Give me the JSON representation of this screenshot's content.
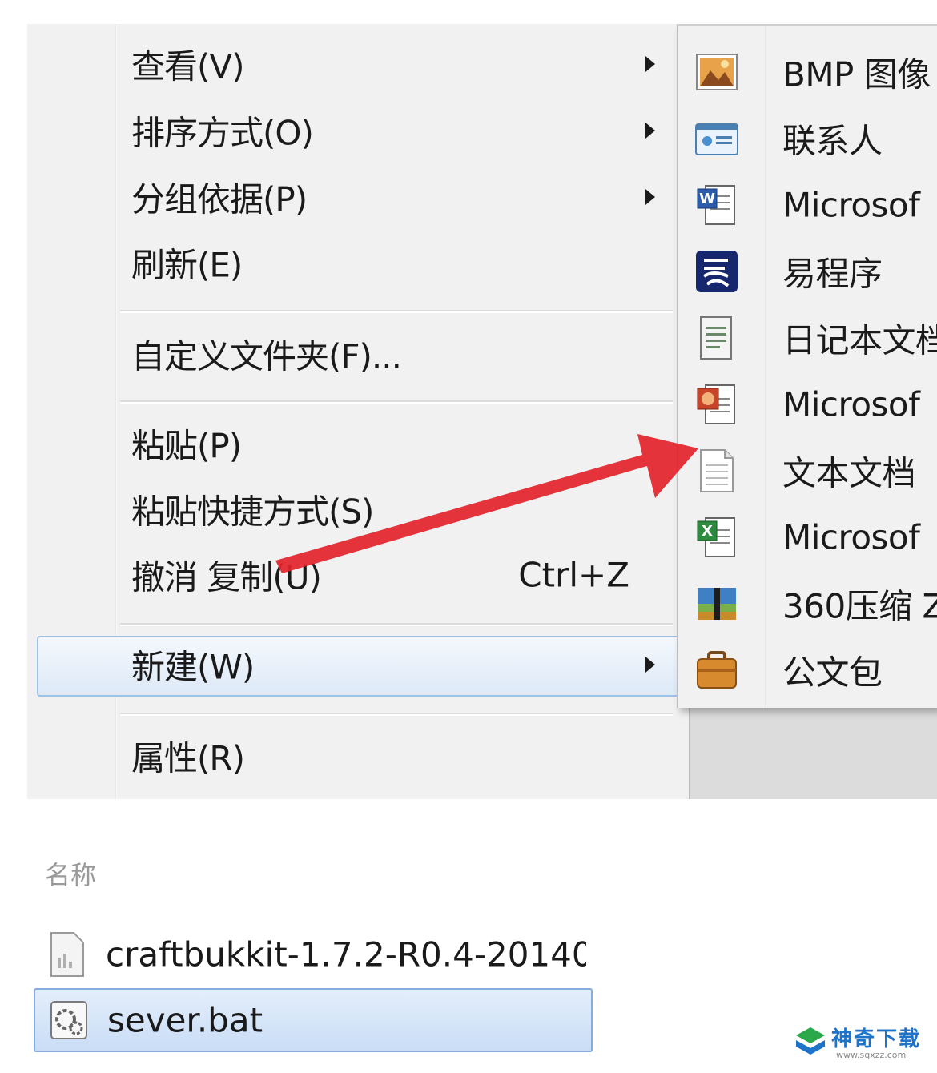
{
  "context_menu": {
    "items": [
      {
        "label": "查看(V)",
        "has_submenu": true
      },
      {
        "label": "排序方式(O)",
        "has_submenu": true
      },
      {
        "label": "分组依据(P)",
        "has_submenu": true
      },
      {
        "label": "刷新(E)",
        "has_submenu": false
      },
      {
        "label": "自定义文件夹(F)...",
        "has_submenu": false
      },
      {
        "label": "粘贴(P)",
        "has_submenu": false
      },
      {
        "label": "粘贴快捷方式(S)",
        "has_submenu": false
      },
      {
        "label": "撤消 复制(U)",
        "shortcut": "Ctrl+Z",
        "has_submenu": false
      },
      {
        "label": "新建(W)",
        "has_submenu": true,
        "highlighted": true
      },
      {
        "label": "属性(R)",
        "has_submenu": false
      }
    ]
  },
  "new_submenu": {
    "items": [
      {
        "label": "BMP 图像",
        "icon": "bmp-image-icon"
      },
      {
        "label": "联系人",
        "icon": "contact-card-icon"
      },
      {
        "label": "Microsof",
        "icon": "word-document-icon"
      },
      {
        "label": "易程序",
        "icon": "e-language-icon"
      },
      {
        "label": "日记本文档",
        "icon": "journal-document-icon"
      },
      {
        "label": "Microsof",
        "icon": "powerpoint-document-icon"
      },
      {
        "label": "文本文档",
        "icon": "text-document-icon"
      },
      {
        "label": "Microsof",
        "icon": "excel-document-icon"
      },
      {
        "label": "360压缩 Z",
        "icon": "archive-icon"
      },
      {
        "label": "公文包",
        "icon": "briefcase-icon"
      }
    ]
  },
  "file_list": {
    "column_header": "名称",
    "files": [
      {
        "name": "craftbukkit-1.7.2-R0.4-20140",
        "icon": "jar-file-icon",
        "selected": false
      },
      {
        "name": "sever.bat",
        "icon": "batch-file-icon",
        "selected": true
      }
    ]
  },
  "watermark": {
    "title": "神奇下载",
    "url": "www.sqxzz.com"
  },
  "colors": {
    "menu_background": "#f1f1f1",
    "highlight_border": "#9fc3e8",
    "selection_fill": "#c9ddf6",
    "arrow_red": "#e3232b",
    "watermark_blue": "#1f73c9"
  }
}
